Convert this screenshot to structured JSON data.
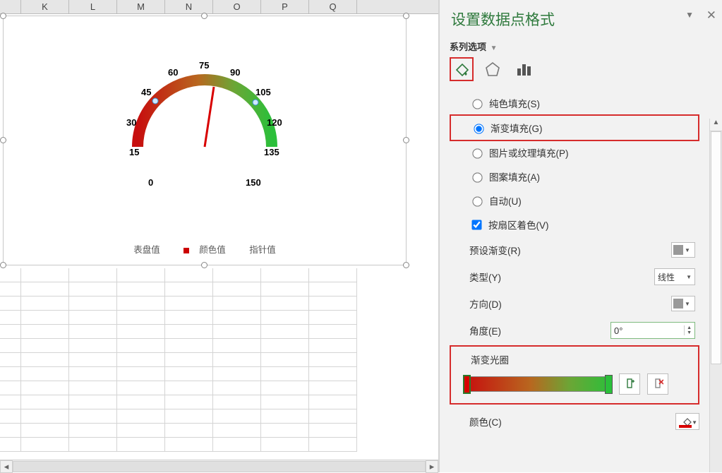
{
  "columns": [
    "",
    "K",
    "L",
    "M",
    "N",
    "O",
    "P",
    "Q"
  ],
  "chart_data": {
    "type": "gauge",
    "ticks": [
      0,
      15,
      30,
      45,
      60,
      75,
      90,
      105,
      120,
      135,
      150
    ],
    "needle_value": 80,
    "arc_gradient": [
      "#c70e0e",
      "#b8671f",
      "#6ba636",
      "#2bbf3a"
    ],
    "legend": [
      "表盘值",
      "颜色值",
      "指针值"
    ]
  },
  "pane": {
    "title": "设置数据点格式",
    "series_label": "系列选项",
    "fill_options": {
      "solid": "纯色填充(S)",
      "gradient": "渐变填充(G)",
      "picture": "图片或纹理填充(P)",
      "pattern": "图案填充(A)",
      "auto": "自动(U)",
      "vary": "按扇区着色(V)",
      "selected": "gradient",
      "vary_checked": true
    },
    "props": {
      "preset": "预设渐变(R)",
      "type_label": "类型(Y)",
      "type_value": "线性",
      "direction": "方向(D)",
      "angle_label": "角度(E)",
      "angle_value": "0°"
    },
    "gradient": {
      "title": "渐变光圈",
      "stops_colors": [
        "#d80000",
        "#2bbf3a"
      ]
    },
    "color_label": "颜色(C)"
  }
}
